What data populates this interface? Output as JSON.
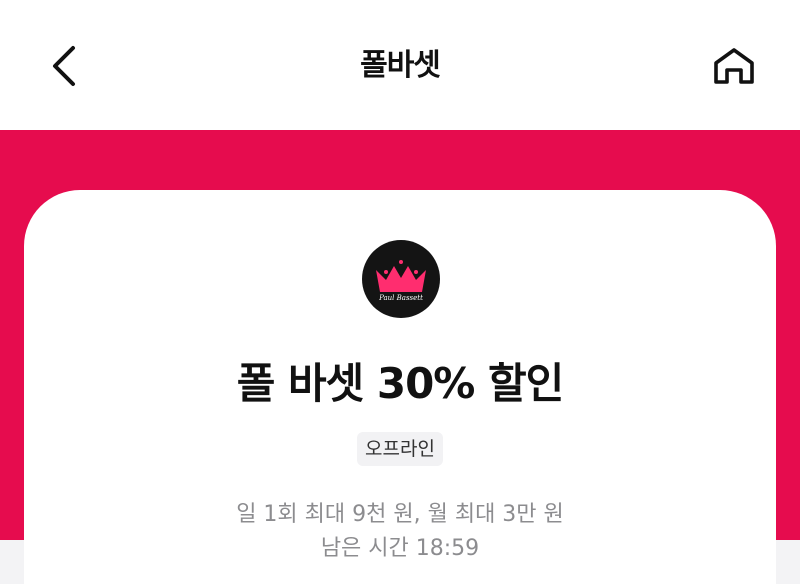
{
  "header": {
    "title": "폴바셋"
  },
  "offer": {
    "brand_logo_text": "Paul Bassett",
    "title": "폴 바셋 30% 할인",
    "tag": "오프라인",
    "limit": "일 1회 최대 9천 원, 월 최대 3만 원",
    "remaining_time": "남은 시간 18:59"
  },
  "colors": {
    "accent": "#e60c4e",
    "text_primary": "#111111",
    "text_secondary": "#8c8c8f",
    "logo_crown": "#ff2d6f"
  },
  "icons": {
    "back": "chevron-left-icon",
    "home": "home-icon"
  }
}
